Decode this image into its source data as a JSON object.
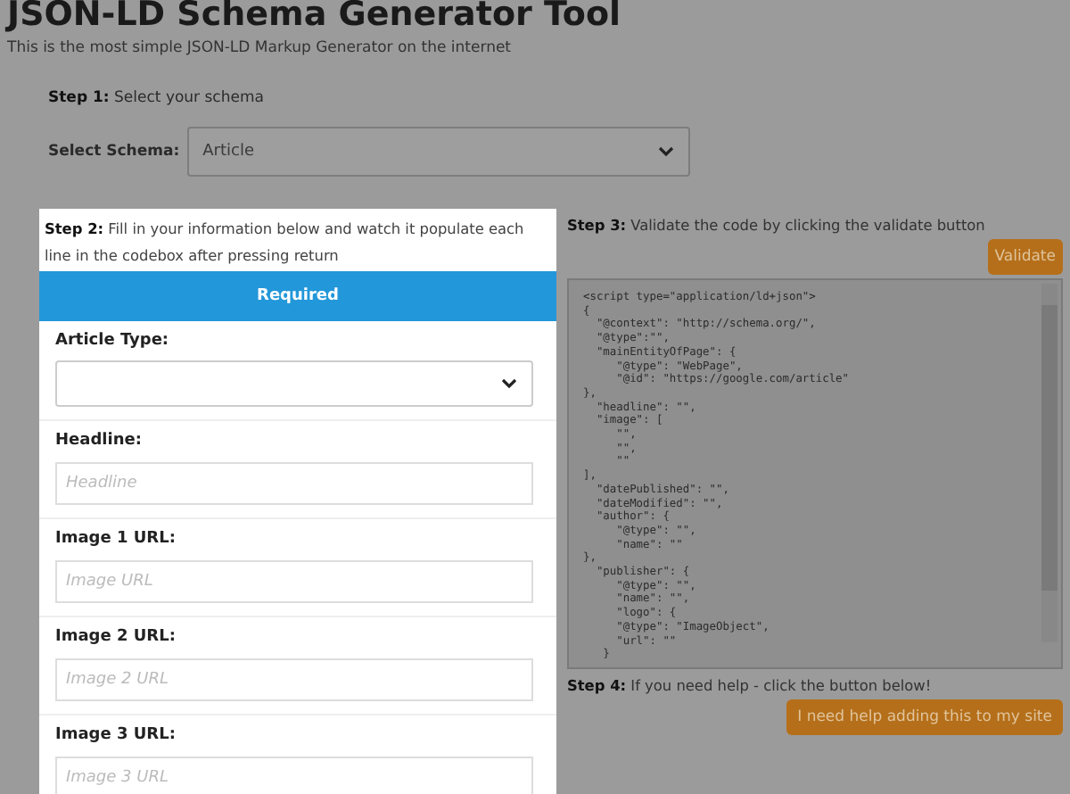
{
  "header": {
    "title": "JSON-LD Schema Generator Tool",
    "subtitle": "This is the most simple JSON-LD Markup Generator on the internet"
  },
  "step1": {
    "label": "Step 1:",
    "text": "Select your schema",
    "select_label": "Select Schema:",
    "select_value": "Article"
  },
  "step2": {
    "label": "Step 2:",
    "text": "Fill in your information below and watch it populate each line in the codebox after pressing return",
    "section": "Required",
    "fields": [
      {
        "kind": "select",
        "label": "Article Type:"
      },
      {
        "kind": "text",
        "label": "Headline:",
        "placeholder": "Headline"
      },
      {
        "kind": "text",
        "label": "Image 1 URL:",
        "placeholder": "Image URL"
      },
      {
        "kind": "text",
        "label": "Image 2 URL:",
        "placeholder": "Image 2 URL"
      },
      {
        "kind": "text",
        "label": "Image 3 URL:",
        "placeholder": "Image 3 URL"
      }
    ]
  },
  "step3": {
    "label": "Step 3:",
    "text": "Validate the code by clicking the validate button",
    "button": "Validate",
    "code": [
      "<script type=\"application/ld+json\">",
      "{",
      "  \"@context\": \"http://schema.org/\",",
      "  \"@type\":\"\",",
      "  \"mainEntityOfPage\": {",
      "     \"@type\": \"WebPage\",",
      "     \"@id\": \"https://google.com/article\"",
      "},",
      "  \"headline\": \"\",",
      "  \"image\": [",
      "     \"\",",
      "     \"\",",
      "     \"\"",
      "],",
      "  \"datePublished\": \"\",",
      "  \"dateModified\": \"\",",
      "  \"author\": {",
      "     \"@type\": \"\",",
      "     \"name\": \"\"",
      "},",
      "  \"publisher\": {",
      "     \"@type\": \"\",",
      "     \"name\": \"\",",
      "     \"logo\": {",
      "     \"@type\": \"ImageObject\",",
      "     \"url\": \"\"",
      "   }"
    ]
  },
  "step4": {
    "label": "Step 4:",
    "text": "If you need help - click the button below!",
    "button": "I need help adding this to my site"
  }
}
